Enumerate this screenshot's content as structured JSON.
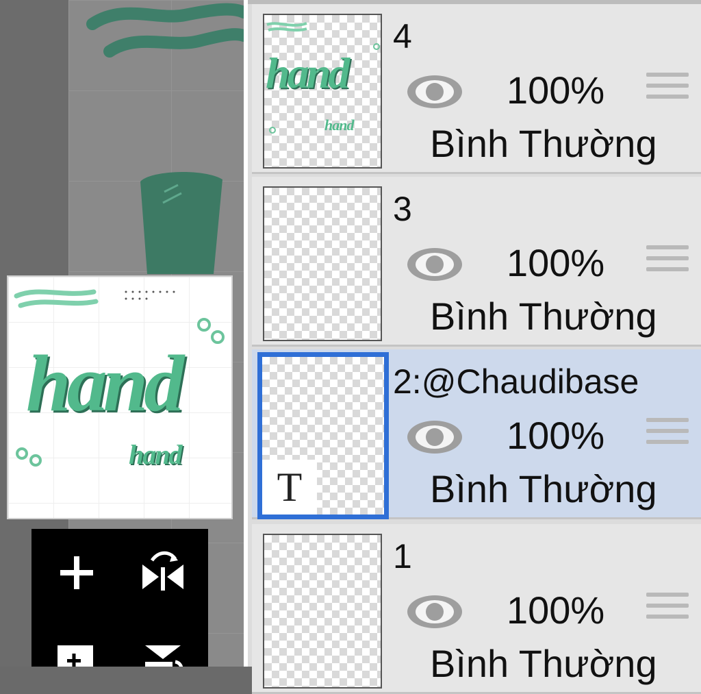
{
  "canvas": {
    "preview_words": {
      "big": "hand",
      "small": "hand"
    }
  },
  "tools": [
    {
      "icon": "plus-icon"
    },
    {
      "icon": "flip-horizontal-icon"
    },
    {
      "icon": "add-layer-icon"
    },
    {
      "icon": "merge-down-icon"
    }
  ],
  "layers": [
    {
      "name": "4",
      "opacity": "100%",
      "blend": "Bình Thường",
      "visible": true,
      "selected": false,
      "thumb_text": "hand",
      "thumb_small": "hand"
    },
    {
      "name": "3",
      "opacity": "100%",
      "blend": "Bình Thường",
      "visible": true,
      "selected": false
    },
    {
      "name": "2:@Chaudibase",
      "opacity": "100%",
      "blend": "Bình Thường",
      "visible": true,
      "selected": true,
      "type_badge": "T"
    },
    {
      "name": "1",
      "opacity": "100%",
      "blend": "Bình Thường",
      "visible": true,
      "selected": false
    }
  ],
  "colors": {
    "accent": "#2f6fd6",
    "selected_row": "#cdd9ec",
    "art_green": "#3fae82"
  }
}
